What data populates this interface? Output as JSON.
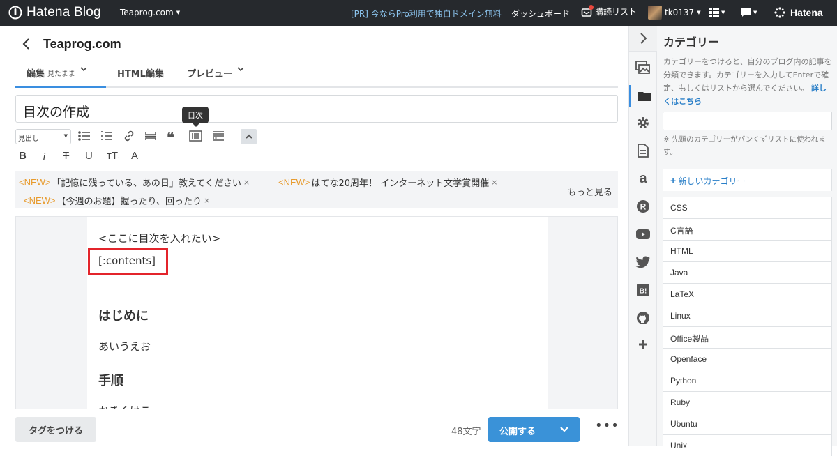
{
  "topbar": {
    "logo_text": "Hatena Blog",
    "blog_name": "Teaprog.com",
    "pr_text": "[PR] 今ならPro利用で独自ドメイン無料",
    "dashboard": "ダッシュボード",
    "reading_list": "購読リスト",
    "username": "tk0137",
    "hatena": "Hatena"
  },
  "editor": {
    "blog_title": "Teaprog.com",
    "tabs": [
      {
        "label": "編集",
        "sub": "見たまま"
      },
      {
        "label": "HTML編集"
      },
      {
        "label": "プレビュー"
      }
    ],
    "article_title": "目次の作成",
    "toolbar": {
      "heading_select": "見出し",
      "tooltip": "目次"
    },
    "news": {
      "tag": "<NEW>",
      "items": [
        "「記憶に残っている、あの日」教えてください",
        "はてな20周年！ インターネット文学賞開催",
        "【今週のお題】握ったり、回ったり"
      ],
      "close": "×",
      "more": "もっと見る"
    },
    "content": {
      "line1": "<ここに目次を入れたい>",
      "line2": "[:contents]",
      "heading1": "はじめに",
      "text1": "あいうえお",
      "heading2": "手順",
      "text2": "かきくけこ"
    },
    "bottom": {
      "tag_button": "タグをつける",
      "char_count": "48文字",
      "publish": "公開する"
    }
  },
  "panel": {
    "title": "カテゴリー",
    "description": "カテゴリーをつけると、自分のブログ内の記事を分類できます。カテゴリーを入力してEnterで確定、もしくはリストから選んでください。",
    "link": "詳しくはこちら",
    "note": "※ 先頭のカテゴリーがパンくずリストに使われます。",
    "new_category": "新しいカテゴリー",
    "categories": [
      "CSS",
      "C言語",
      "HTML",
      "Java",
      "LaTeX",
      "Linux",
      "Office製品",
      "Openface",
      "Python",
      "Ruby",
      "Ubuntu",
      "Unix"
    ]
  },
  "colors": {
    "accent": "#3a92d8",
    "topbar": "#26292d",
    "new_tag": "#e79b2e",
    "highlight_box": "#e3242b"
  }
}
